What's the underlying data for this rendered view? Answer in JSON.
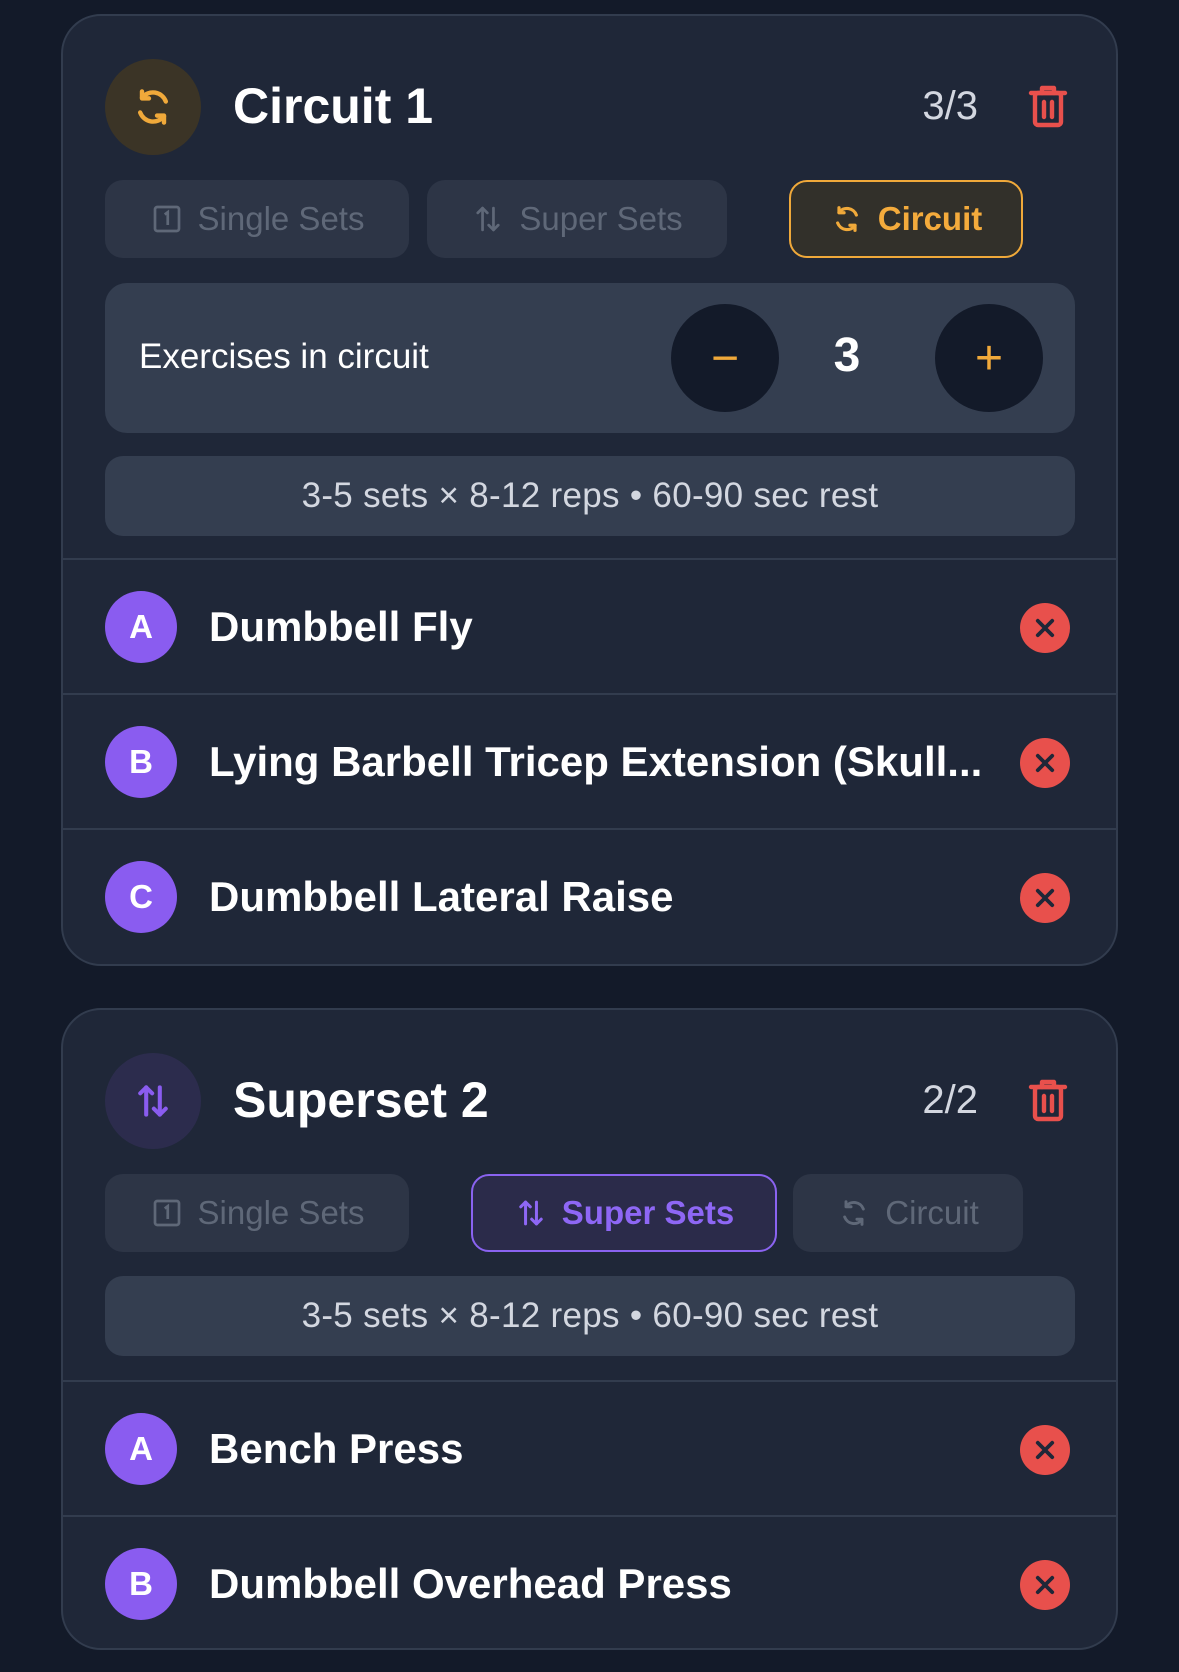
{
  "colors": {
    "background": "#131a29",
    "card": "#1f2738",
    "accent_orange": "#f0a93a",
    "accent_purple": "#8a5cf0",
    "danger": "#e8504c"
  },
  "circuit": {
    "icon": "circuit-refresh-icon",
    "title": "Circuit 1",
    "count": "3/3",
    "modes": {
      "single": "Single Sets",
      "super": "Super Sets",
      "circuit": "Circuit",
      "selected": "circuit"
    },
    "stepper": {
      "label": "Exercises in circuit",
      "minus": "−",
      "plus": "+",
      "value": "3"
    },
    "info": "3-5 sets × 8-12 reps • 60-90 sec rest",
    "exercises": [
      {
        "letter": "A",
        "name": "Dumbbell Fly"
      },
      {
        "letter": "B",
        "name": "Lying Barbell Tricep Extension (Skull..."
      },
      {
        "letter": "C",
        "name": "Dumbbell Lateral Raise"
      }
    ]
  },
  "superset": {
    "icon": "superset-arrows-icon",
    "title": "Superset 2",
    "count": "2/2",
    "modes": {
      "single": "Single Sets",
      "super": "Super Sets",
      "circuit": "Circuit",
      "selected": "super"
    },
    "info": "3-5 sets × 8-12 reps • 60-90 sec rest",
    "exercises": [
      {
        "letter": "A",
        "name": "Bench Press"
      },
      {
        "letter": "B",
        "name": "Dumbbell Overhead Press"
      }
    ]
  }
}
